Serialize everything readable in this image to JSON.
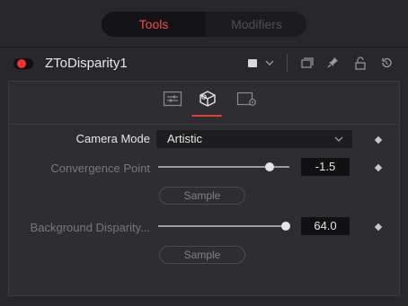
{
  "tabs": [
    {
      "label": "Tools",
      "active": true
    },
    {
      "label": "Modifiers",
      "active": false
    }
  ],
  "node": {
    "name": "ZToDisparity1",
    "enabled": true,
    "color_chip": "#d9d9dc",
    "header_icons": [
      "color-chip",
      "chevron-down-icon",
      "versions-icon",
      "pin-icon",
      "lock-icon",
      "reset-icon"
    ]
  },
  "subtabs": [
    {
      "icon": "controls-icon",
      "active": false
    },
    {
      "icon": "3d-camera-icon",
      "active": true
    },
    {
      "icon": "settings-icon",
      "active": false
    }
  ],
  "controls": {
    "camera_mode": {
      "label": "Camera Mode",
      "value": "Artistic"
    },
    "convergence_point": {
      "label": "Convergence Point",
      "value": "-1.5",
      "slider_fraction": 0.85
    },
    "sample_1": "Sample",
    "background_disparity": {
      "label": "Background Disparity...",
      "value": "64.0",
      "slider_fraction": 0.97
    },
    "sample_2": "Sample"
  },
  "colors": {
    "accent": "#ef4a4a",
    "record_red": "#f0322c",
    "panel_bg": "#2e2e32",
    "window_bg": "#28282c"
  }
}
